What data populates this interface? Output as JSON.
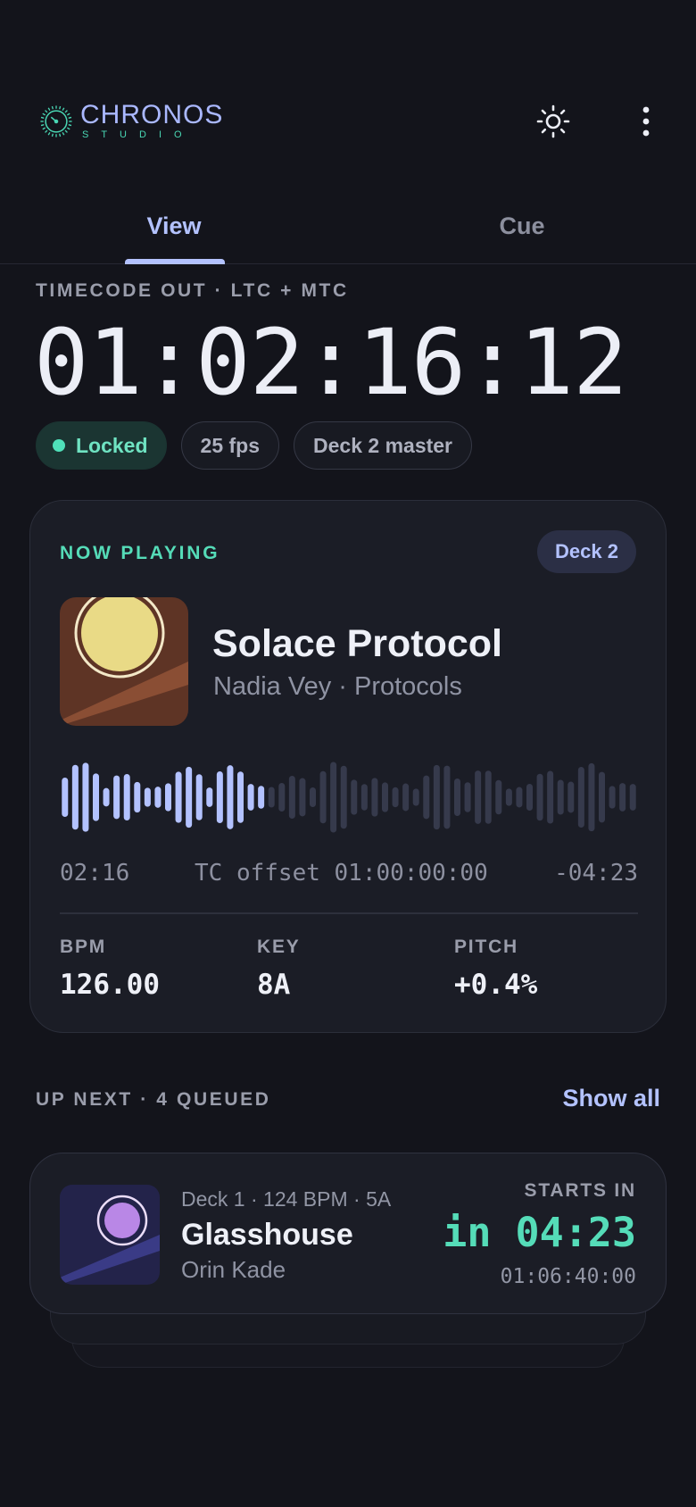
{
  "app": {
    "logo_title": "CHRONOS",
    "logo_subtitle": "STUDIO",
    "accent": "#b3c2ff",
    "success": "#55dcb8"
  },
  "header": {
    "theme_icon": "sun-icon",
    "menu_icon": "more-vertical-icon"
  },
  "tabs": [
    {
      "label": "View",
      "active": true
    },
    {
      "label": "Cue",
      "active": false
    }
  ],
  "timecode": {
    "label": "TIMECODE OUT · LTC + MTC",
    "value": "01:02:16:12",
    "chips": {
      "locked": "Locked",
      "fps": "25 fps",
      "master": "Deck 2 master"
    }
  },
  "now_playing": {
    "label": "NOW PLAYING",
    "deck": "Deck 2",
    "title": "Solace Protocol",
    "subtitle": "Nadia Vey · Protocols",
    "elapsed": "02:16",
    "tc_offset": "TC offset 01:00:00:00",
    "remaining": "-04:23",
    "progress": 0.34,
    "stats": {
      "bpm_label": "BPM",
      "bpm_value": "126.00",
      "key_label": "KEY",
      "key_value": "8A",
      "pitch_label": "PITCH",
      "pitch_value": "+0.4%"
    }
  },
  "up_next": {
    "label": "UP NEXT · 4 QUEUED",
    "show_all": "Show all",
    "item": {
      "meta": "Deck 1 · 124 BPM · 5A",
      "title": "Glasshouse",
      "artist": "Orin Kade",
      "starts_label": "STARTS IN",
      "starts_value": "in 04:23",
      "starts_tc": "01:06:40:00"
    }
  }
}
